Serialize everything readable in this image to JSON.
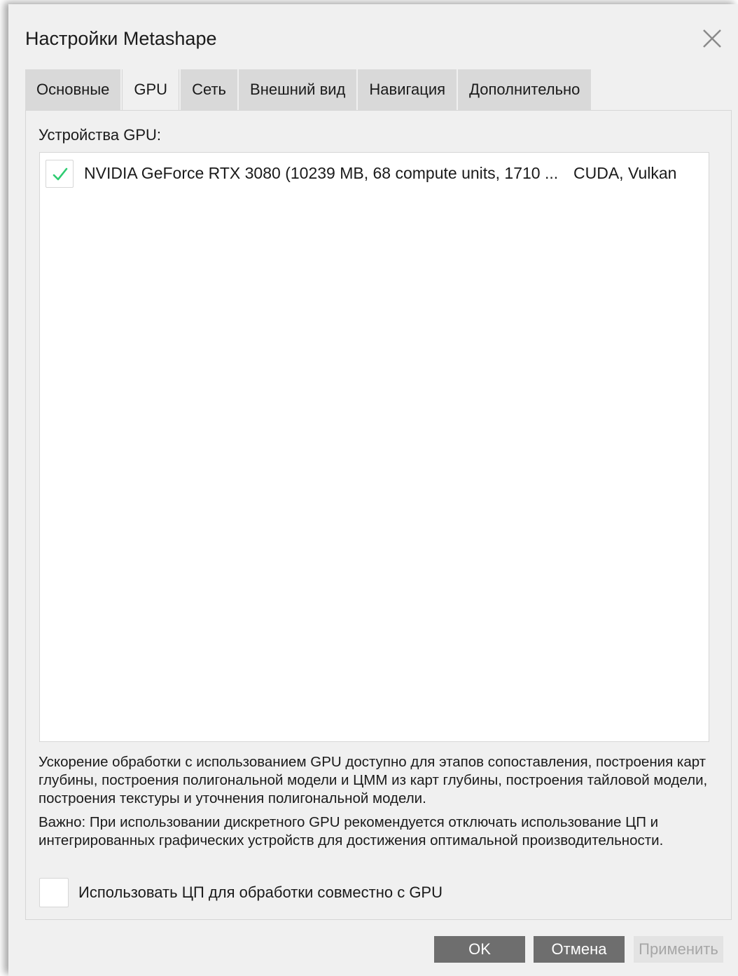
{
  "window": {
    "title": "Настройки Metashape"
  },
  "tabs": [
    {
      "label": "Основные",
      "active": false
    },
    {
      "label": "GPU",
      "active": true
    },
    {
      "label": "Сеть",
      "active": false
    },
    {
      "label": "Внешний вид",
      "active": false
    },
    {
      "label": "Навигация",
      "active": false
    },
    {
      "label": "Дополнительно",
      "active": false
    }
  ],
  "gpu_panel": {
    "devices_label": "Устройства GPU:",
    "devices": [
      {
        "name": "NVIDIA GeForce RTX 3080 (10239 MB, 68 compute units, 1710 ...",
        "api": "CUDA, Vulkan",
        "checked": true
      }
    ],
    "info_text": "Ускорение обработки с использованием GPU доступно для этапов сопоставления, построения карт глубины, построения полигональной модели и ЦММ из карт глубины, построения тайловой модели, построения текстуры и уточнения полигональной модели.",
    "warning_text": "Важно: При использовании дискретного GPU рекомендуется отключать использование ЦП и интегрированных графических устройств для достижения оптимальной производительности.",
    "use_cpu_label": "Использовать ЦП для обработки совместно с GPU",
    "use_cpu_checked": false
  },
  "buttons": {
    "ok": "OK",
    "cancel": "Отмена",
    "apply": "Применить"
  },
  "icons": {
    "close": "close-icon",
    "check": "checkmark-icon"
  },
  "colors": {
    "checkmark": "#2ecc71",
    "dialog_bg": "#f0f0f0",
    "button_bg": "#6e6e6e",
    "button_disabled_bg": "#e3e3e3"
  }
}
